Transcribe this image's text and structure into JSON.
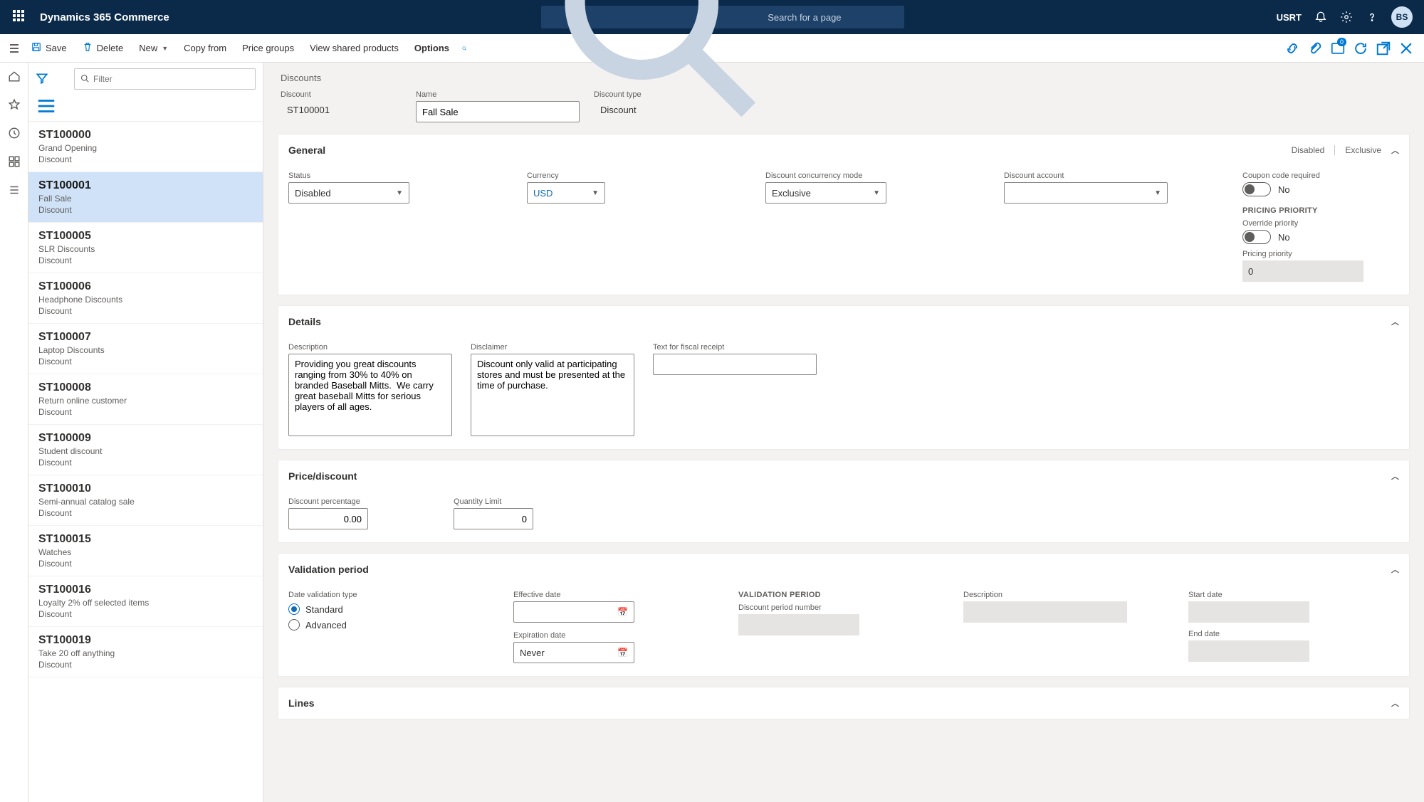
{
  "app": {
    "title": "Dynamics 365 Commerce"
  },
  "search": {
    "placeholder": "Search for a page"
  },
  "org": "USRT",
  "avatar": "BS",
  "commands": {
    "save": "Save",
    "delete": "Delete",
    "new": "New",
    "copy_from": "Copy from",
    "price_groups": "Price groups",
    "view_shared": "View shared products",
    "options": "Options"
  },
  "notif_count": "0",
  "list": {
    "filter_placeholder": "Filter",
    "items": [
      {
        "code": "ST100000",
        "name": "Grand Opening",
        "type": "Discount"
      },
      {
        "code": "ST100001",
        "name": "Fall Sale",
        "type": "Discount"
      },
      {
        "code": "ST100005",
        "name": "SLR Discounts",
        "type": "Discount"
      },
      {
        "code": "ST100006",
        "name": "Headphone Discounts",
        "type": "Discount"
      },
      {
        "code": "ST100007",
        "name": "Laptop Discounts",
        "type": "Discount"
      },
      {
        "code": "ST100008",
        "name": "Return online customer",
        "type": "Discount"
      },
      {
        "code": "ST100009",
        "name": "Student discount",
        "type": "Discount"
      },
      {
        "code": "ST100010",
        "name": "Semi-annual catalog sale",
        "type": "Discount"
      },
      {
        "code": "ST100015",
        "name": "Watches",
        "type": "Discount"
      },
      {
        "code": "ST100016",
        "name": "Loyalty 2% off selected items",
        "type": "Discount"
      },
      {
        "code": "ST100019",
        "name": "Take 20 off anything",
        "type": "Discount"
      }
    ],
    "selected_index": 1
  },
  "page": {
    "title": "Discounts"
  },
  "header_fields": {
    "discount_label": "Discount",
    "discount_value": "ST100001",
    "name_label": "Name",
    "name_value": "Fall Sale",
    "type_label": "Discount type",
    "type_value": "Discount"
  },
  "general": {
    "title": "General",
    "tags": {
      "disabled": "Disabled",
      "exclusive": "Exclusive"
    },
    "status_label": "Status",
    "status_value": "Disabled",
    "currency_label": "Currency",
    "currency_value": "USD",
    "concurrency_label": "Discount concurrency mode",
    "concurrency_value": "Exclusive",
    "account_label": "Discount account",
    "account_value": "",
    "coupon_label": "Coupon code required",
    "coupon_value": "No",
    "pricing_priority_header": "PRICING PRIORITY",
    "override_label": "Override priority",
    "override_value": "No",
    "priority_label": "Pricing priority",
    "priority_value": "0"
  },
  "details": {
    "title": "Details",
    "description_label": "Description",
    "description_value": "Providing you great discounts ranging from 30% to 40% on branded Baseball Mitts.  We carry great baseball Mitts for serious players of all ages.",
    "disclaimer_label": "Disclaimer",
    "disclaimer_value": "Discount only valid at participating stores and must be presented at the time of purchase.",
    "fiscal_label": "Text for fiscal receipt",
    "fiscal_value": ""
  },
  "price": {
    "title": "Price/discount",
    "percent_label": "Discount percentage",
    "percent_value": "0.00",
    "qty_label": "Quantity Limit",
    "qty_value": "0"
  },
  "validation": {
    "title": "Validation period",
    "type_label": "Date validation type",
    "standard": "Standard",
    "advanced": "Advanced",
    "effective_label": "Effective date",
    "effective_value": "",
    "expiration_label": "Expiration date",
    "expiration_value": "Never",
    "vp_header": "VALIDATION PERIOD",
    "dpn_label": "Discount period number",
    "desc_label": "Description",
    "start_label": "Start date",
    "end_label": "End date"
  },
  "lines": {
    "title": "Lines"
  }
}
